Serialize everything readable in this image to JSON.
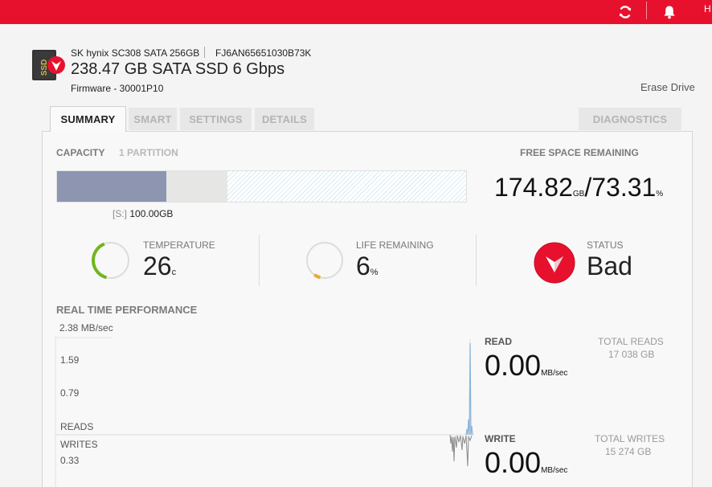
{
  "topbar": {
    "user_initial": "H",
    "colors": {
      "bar": "#e8112d",
      "icon": "#ffffff"
    },
    "icons": [
      "refresh-icon",
      "bell-icon"
    ]
  },
  "drive": {
    "model": "SK hynix SC308 SATA 256GB",
    "serial": "FJ6AN65651030B73K",
    "title": "238.47 GB SATA SSD 6 Gbps",
    "firmware": "Firmware - 30001P10",
    "icon_text": "SSD",
    "erase_label": "Erase Drive"
  },
  "tabs": [
    {
      "label": "SUMMARY",
      "active": true
    },
    {
      "label": "SMART",
      "active": false
    },
    {
      "label": "SETTINGS",
      "active": false
    },
    {
      "label": "DETAILS",
      "active": false
    }
  ],
  "diagnostics_label": "DIAGNOSTICS",
  "capacity": {
    "label": "CAPACITY",
    "partitions": "1 PARTITION",
    "partition_drive": "[S:]",
    "partition_size": "100.00GB",
    "used_fraction": 0.268,
    "system_fraction": 0.15,
    "colors": {
      "used": "#8d95b1",
      "system": "#e6e6e4",
      "free_stripe": "#d9ecf3"
    }
  },
  "free_space": {
    "label": "FREE SPACE REMAINING",
    "value": "174.82",
    "value_unit": "GB",
    "separator": "/",
    "percent": "73.31",
    "percent_unit": "%"
  },
  "temperature": {
    "label": "TEMPERATURE",
    "value": "26",
    "unit": "c",
    "gauge_fraction": 0.4,
    "color": "#6fb61e"
  },
  "life": {
    "label": "LIFE REMAINING",
    "value": "6",
    "unit": "%",
    "gauge_fraction": 0.06,
    "color": "#f0a830"
  },
  "status": {
    "label": "STATUS",
    "value": "Bad",
    "color": "#e8112d"
  },
  "performance": {
    "title": "REAL TIME PERFORMANCE",
    "axis": {
      "max": "2.38 MB/sec",
      "mid1": "1.59",
      "mid2": "0.79",
      "reads": "READS",
      "writes": "WRITES",
      "wlabel": "0.33"
    },
    "read": {
      "label": "READ",
      "value": "0.00",
      "unit": "MB/sec",
      "total_label": "TOTAL READS",
      "total_value": "17 038 GB"
    },
    "write": {
      "label": "WRITE",
      "value": "0.00",
      "unit": "MB/sec",
      "total_label": "TOTAL WRITES",
      "total_value": "15 274 GB"
    },
    "colors": {
      "read_line": "#8ab4d8",
      "write_line": "#8a8a8a"
    }
  }
}
